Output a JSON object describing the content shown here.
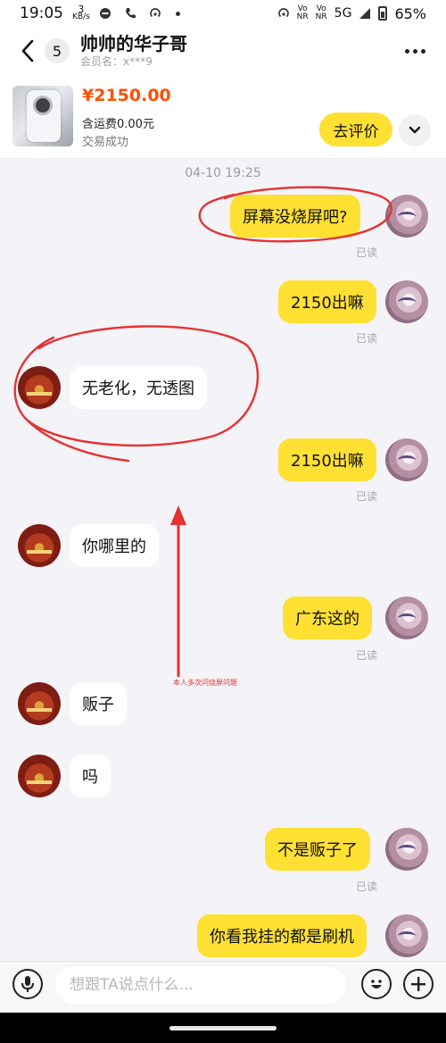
{
  "status_bar": {
    "time": "19:05",
    "net_speed_value": "3",
    "net_speed_unit": "KB/s",
    "volte1": "Vo\nNR",
    "volte2": "Vo\nNR",
    "network": "5G",
    "battery": "65%"
  },
  "header": {
    "unread_count": "5",
    "title": "帅帅的华子哥",
    "member": "会员名：x***9"
  },
  "product": {
    "price": "¥2150.00",
    "shipping": "含运费0.00元",
    "status": "交易成功",
    "review_label": "去评价"
  },
  "chat": {
    "timestamp": "04-10 19:25",
    "read_label": "已读",
    "messages": [
      {
        "from": "me",
        "text": "屏幕没烧屏吧?"
      },
      {
        "from": "me",
        "text": "2150出嘛"
      },
      {
        "from": "seller",
        "text": "无老化，无透图"
      },
      {
        "from": "me",
        "text": "2150出嘛"
      },
      {
        "from": "seller",
        "text": "你哪里的"
      },
      {
        "from": "me",
        "text": "广东这的"
      },
      {
        "from": "seller",
        "text": "贩子"
      },
      {
        "from": "seller",
        "text": "吗"
      },
      {
        "from": "me",
        "text": "不是贩子了"
      },
      {
        "from": "me",
        "text": "你看我挂的都是刷机"
      }
    ]
  },
  "annotation": {
    "note": "本人多次问烧屏问题",
    "color": "#e53232"
  },
  "input": {
    "placeholder": "想跟TA说点什么..."
  },
  "colors": {
    "accent_yellow": "#ffe033",
    "price_orange": "#ff5000"
  }
}
